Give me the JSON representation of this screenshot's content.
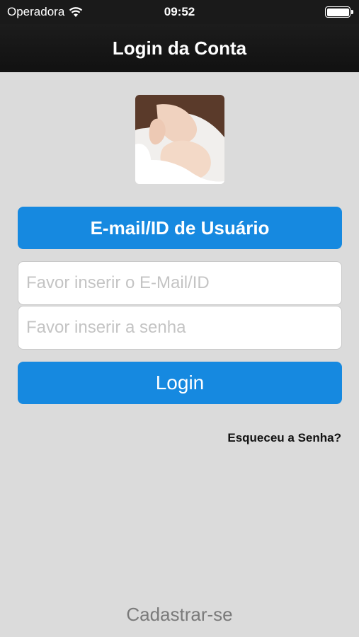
{
  "status_bar": {
    "carrier": "Operadora",
    "time": "09:52"
  },
  "nav": {
    "title": "Login da Conta"
  },
  "form": {
    "header_label": "E-mail/ID de Usuário",
    "email_placeholder": "Favor inserir o E-Mail/ID",
    "password_placeholder": "Favor inserir a senha",
    "login_label": "Login",
    "forgot_label": "Esqueceu a Senha?"
  },
  "footer": {
    "signup_label": "Cadastrar-se"
  },
  "colors": {
    "accent": "#1689e0",
    "background": "#dbdbdb",
    "navbar": "#141414"
  },
  "icons": {
    "wifi": "wifi-icon",
    "battery": "battery-icon"
  }
}
